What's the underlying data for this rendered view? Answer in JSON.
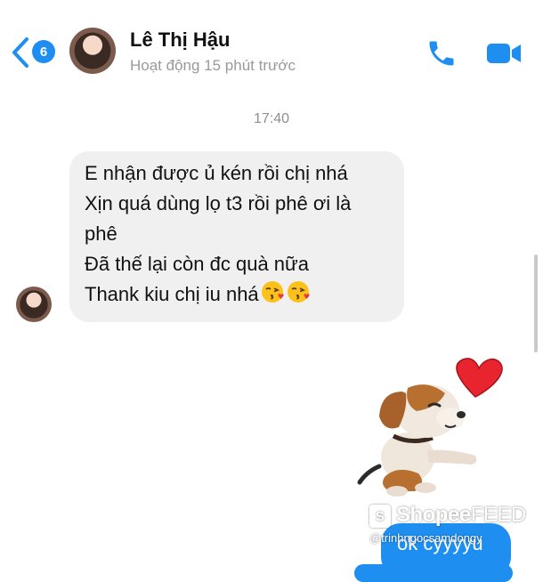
{
  "header": {
    "unread_count": "6",
    "contact_name": "Lê Thị Hậu",
    "status": "Hoạt động 15 phút trước",
    "accent_color": "#1f8ef1"
  },
  "conversation": {
    "timestamp": "17:40",
    "incoming_message": {
      "lines": [
        "E nhận được ủ kén rồi chị nhá",
        "Xịn quá dùng lọ t3 rồi phê ơi là",
        "phê",
        "Đã thế lại còn đc quà nữa",
        "Thank kiu chị iu nhá"
      ],
      "emoji": "kissing-face-with-heart-emoji"
    },
    "sticker": "puppy-blowing-heart-sticker",
    "outgoing_message": "ok cyyyyu"
  },
  "watermark": {
    "brand_main": "Shopee",
    "brand_sub": "FEED",
    "handle": "@trinhngocsamdongy"
  }
}
